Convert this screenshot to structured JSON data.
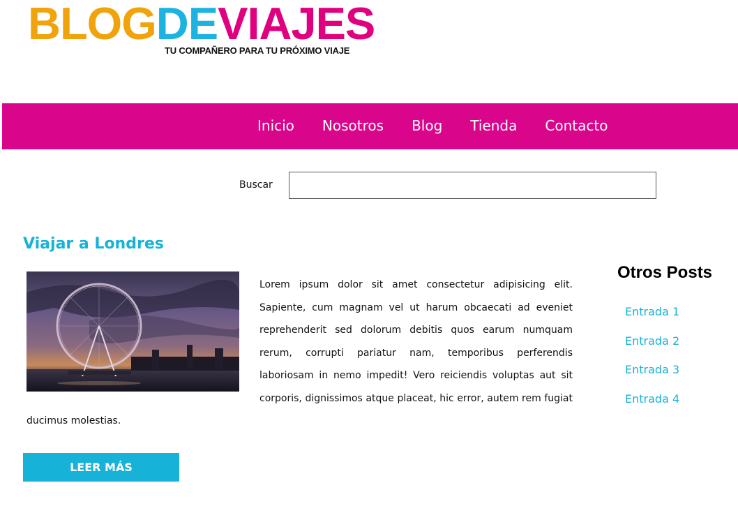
{
  "logo": {
    "part_blog": "BLOG",
    "part_de": "DE",
    "part_viajes": "VIAJES",
    "tagline": "TU COMPAÑERO PARA TU PRÓXIMO VIAJE",
    "colors": {
      "blog": "#f0a30a",
      "de": "#1cb3e0",
      "viajes": "#e0007f"
    }
  },
  "nav": {
    "background": "#d9068c",
    "items": [
      {
        "label": "Inicio"
      },
      {
        "label": "Nosotros"
      },
      {
        "label": "Blog"
      },
      {
        "label": "Tienda"
      },
      {
        "label": "Contacto"
      }
    ]
  },
  "search": {
    "label": "Buscar",
    "value": ""
  },
  "post": {
    "title": "Viajar a Londres",
    "image_icon": "london-eye-photo",
    "body": "Lorem ipsum dolor sit amet consectetur adipisicing elit. Sapiente, cum magnam vel ut harum obcaecati ad eveniet reprehenderit sed dolorum debitis quos earum numquam rerum, corrupti pariatur nam, temporibus perferendis laboriosam in nemo impedit! Vero reiciendis voluptas aut sit corporis, dignissimos atque placeat, hic error, autem rem fugiat ducimus molestias.",
    "read_more_label": "LEER MÁS",
    "accent": "#17b2d8"
  },
  "sidebar": {
    "title": "Otros Posts",
    "items": [
      {
        "label": "Entrada 1"
      },
      {
        "label": "Entrada 2"
      },
      {
        "label": "Entrada 3"
      },
      {
        "label": "Entrada 4"
      }
    ]
  }
}
